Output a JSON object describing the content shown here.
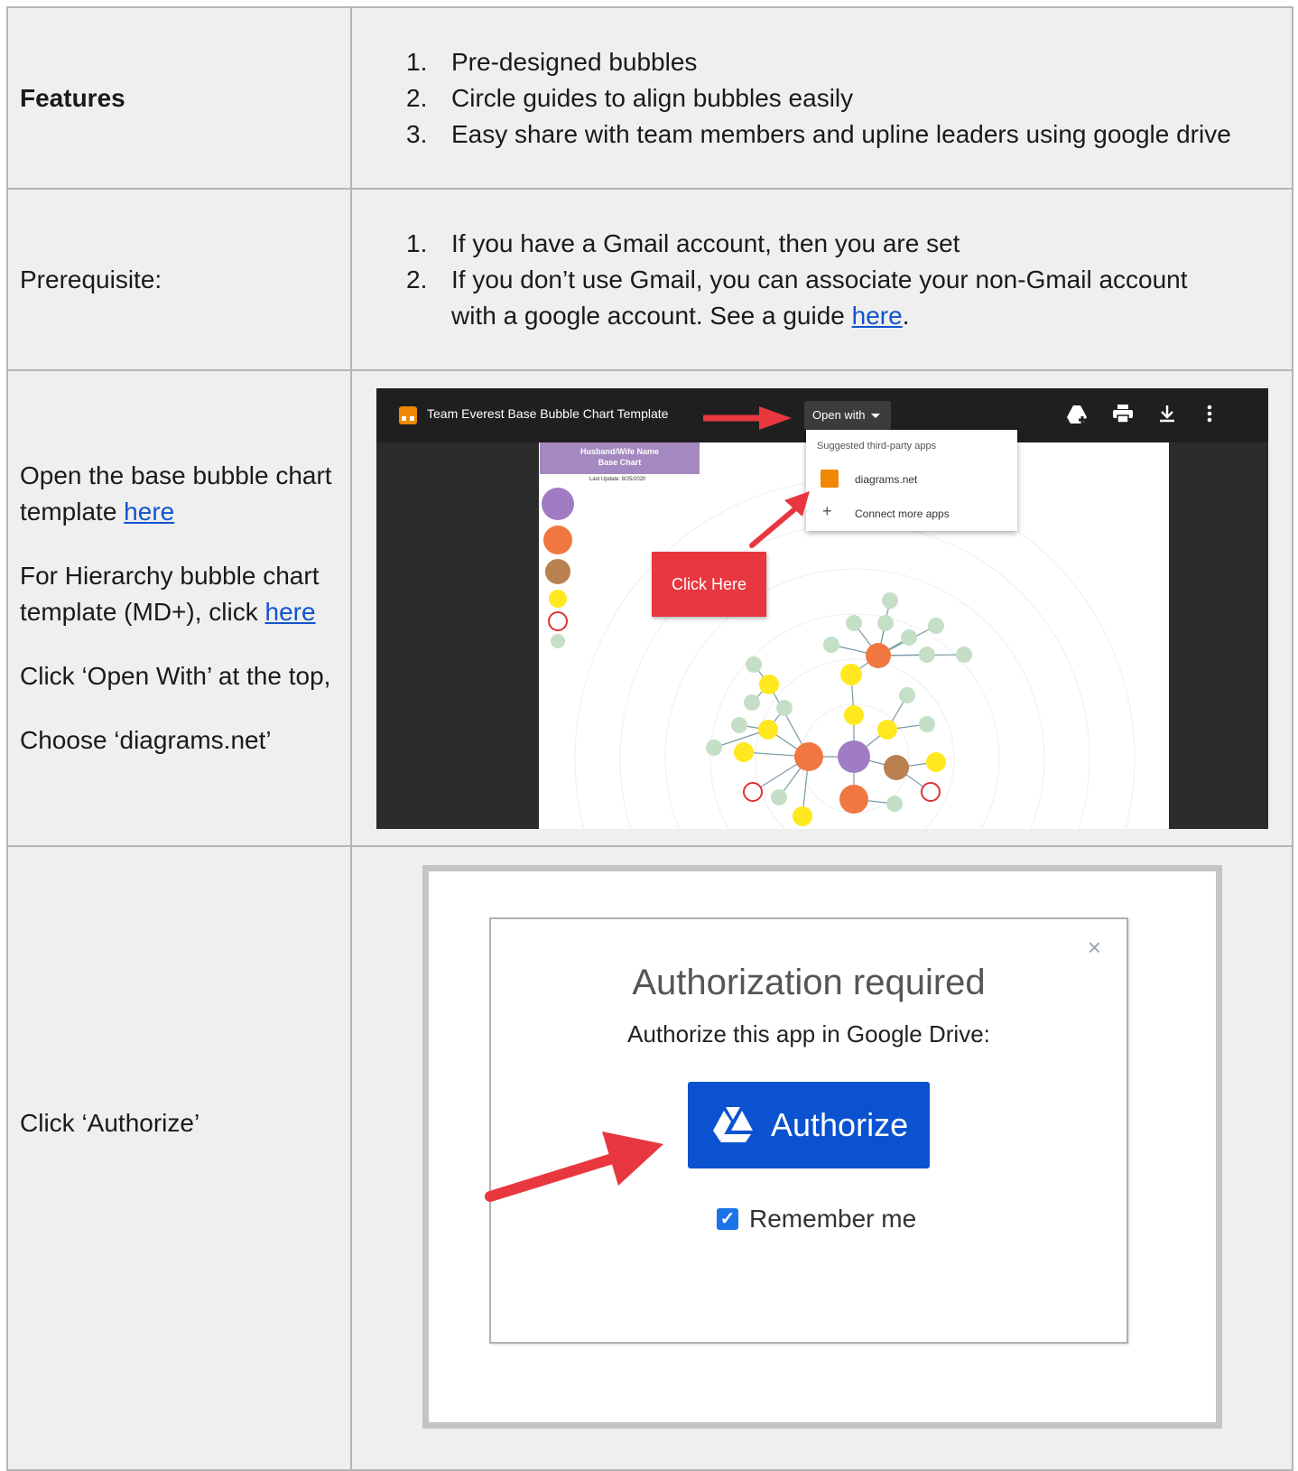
{
  "rows": [
    {
      "label": "Features",
      "items": [
        {
          "num": "1.",
          "text": "Pre-designed bubbles"
        },
        {
          "num": "2.",
          "text": "Circle guides to align bubbles easily"
        },
        {
          "num": "3.",
          "text": "Easy share with team members and upline leaders using google drive"
        }
      ]
    },
    {
      "label": "Prerequisite:",
      "item1_num": "1.",
      "item1_text": "If you have a Gmail account, then you are set",
      "item2_num": "2.",
      "item2_line1": "If you don’t use Gmail, you can associate your non-Gmail account",
      "item2_line2": "with a google account. See a guide ",
      "item2_link": "here",
      "item2_after": "."
    },
    {
      "p1_text": "Open the base bubble chart template ",
      "p1_link": "here",
      "p2_text": "For Hierarchy bubble chart template (MD+), click ",
      "p2_link": "here",
      "p3_text": "Click ‘Open With’ at the top,",
      "p4_text": "Choose ‘diagrams.net’"
    },
    {
      "label": "Click ‘Authorize’"
    }
  ],
  "screenshot1": {
    "file_title": "Team Everest Base Bubble Chart Template",
    "open_with": "Open with",
    "menu_header": "Suggested third-party apps",
    "menu_item1": "diagrams.net",
    "menu_item2": "Connect more apps",
    "callout": "Click Here",
    "header_line1": "Husband/Wife Name",
    "header_line2": "Base Chart",
    "last_update": "Last Update: 8/25/2020",
    "colors": {
      "bar": "#1f1f1f",
      "callout": "#e8373f",
      "purple": "#a07cc5",
      "orange": "#f07840",
      "brown": "#b98050",
      "yellow": "#ffe81f",
      "green": "#c5dfc7"
    }
  },
  "screenshot2": {
    "title": "Authorization required",
    "subtitle": "Authorize this app in Google Drive:",
    "button": "Authorize",
    "remember": "Remember me",
    "close": "×",
    "colors": {
      "button": "#0b52d0",
      "arrow": "#e8373f"
    }
  }
}
